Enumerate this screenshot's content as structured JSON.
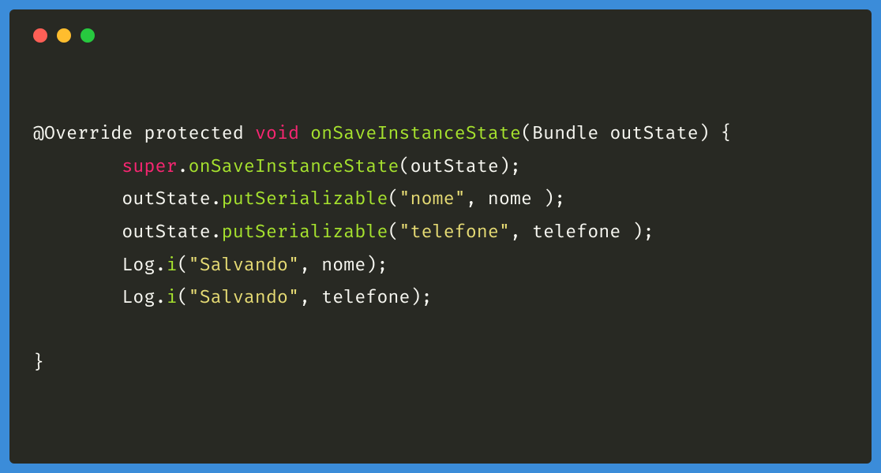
{
  "code": {
    "line1": {
      "annotation": "@Override",
      "modifier": "protected",
      "returnType": "void",
      "methodName": "onSaveInstanceState",
      "paramType": "Bundle",
      "paramName": "outState",
      "brace": "{"
    },
    "line2": {
      "indent": "        ",
      "superKw": "super",
      "dot": ".",
      "method": "onSaveInstanceState",
      "args": "(outState);"
    },
    "line3": {
      "indent": "        ",
      "obj": "outState.",
      "method": "putSerializable",
      "open": "(",
      "str": "\"nome\"",
      "rest": ", nome );"
    },
    "line4": {
      "indent": "        ",
      "obj": "outState.",
      "method": "putSerializable",
      "open": "(",
      "str": "\"telefone\"",
      "rest": ", telefone );"
    },
    "line5": {
      "indent": "        ",
      "obj": "Log.",
      "method": "i",
      "open": "(",
      "str": "\"Salvando\"",
      "rest": ", nome);"
    },
    "line6": {
      "indent": "        ",
      "obj": "Log.",
      "method": "i",
      "open": "(",
      "str": "\"Salvando\"",
      "rest": ", telefone);"
    },
    "line7": "",
    "line8": "}"
  }
}
